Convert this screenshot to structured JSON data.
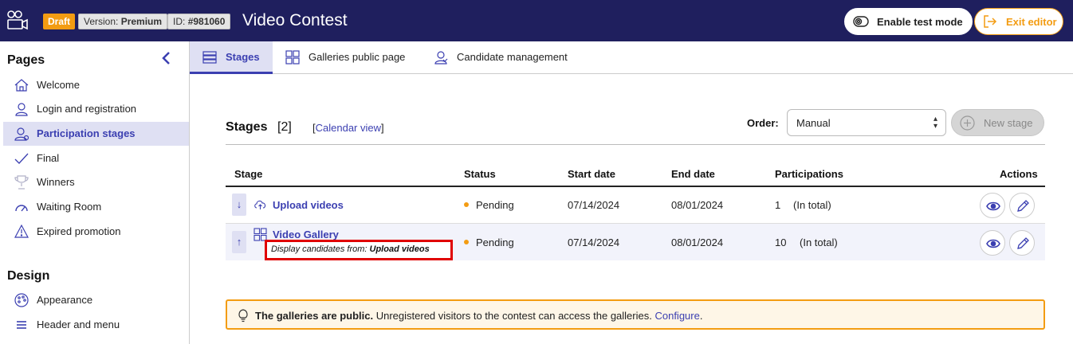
{
  "topbar": {
    "draft_label": "Draft",
    "version_prefix": "Version:",
    "version_value": "Premium",
    "id_prefix": "ID:",
    "id_value": "#981060",
    "title": "Video Contest",
    "test_mode_label": "Enable test mode",
    "exit_label": "Exit editor"
  },
  "sidebar": {
    "pages_heading": "Pages",
    "items": [
      {
        "label": "Welcome",
        "icon": "home-icon"
      },
      {
        "label": "Login and registration",
        "icon": "user-login-icon"
      },
      {
        "label": "Participation stages",
        "icon": "user-stages-icon"
      },
      {
        "label": "Final",
        "icon": "check-icon"
      },
      {
        "label": "Winners",
        "icon": "trophy-icon"
      },
      {
        "label": "Waiting Room",
        "icon": "gauge-icon"
      },
      {
        "label": "Expired promotion",
        "icon": "warning-icon"
      }
    ],
    "design_heading": "Design",
    "design_items": [
      {
        "label": "Appearance",
        "icon": "palette-icon"
      },
      {
        "label": "Header and menu",
        "icon": "menu-icon"
      }
    ]
  },
  "tabs": [
    {
      "label": "Stages",
      "icon": "list-icon"
    },
    {
      "label": "Galleries public page",
      "icon": "grid-icon"
    },
    {
      "label": "Candidate management",
      "icon": "candidates-icon"
    }
  ],
  "stages": {
    "title": "Stages",
    "count": "[2]",
    "calendar_link": "Calendar view",
    "order_label": "Order:",
    "order_value": "Manual",
    "new_stage_label": "New stage",
    "columns": [
      "Stage",
      "Status",
      "Start date",
      "End date",
      "Participations",
      "Actions"
    ],
    "rows": [
      {
        "name": "Upload videos",
        "icon": "cloud-upload-icon",
        "move": "↓",
        "status": "Pending",
        "start": "07/14/2024",
        "end": "08/01/2024",
        "participations": "1",
        "participations_note": "(In total)"
      },
      {
        "name": "Video Gallery",
        "icon": "gallery-grid-icon",
        "move": "↑",
        "sub_prefix": "Display candidates from:",
        "sub_value": "Upload videos",
        "status": "Pending",
        "start": "07/14/2024",
        "end": "08/01/2024",
        "participations": "10",
        "participations_note": "(In total)"
      }
    ]
  },
  "notice": {
    "bold": "The galleries are public.",
    "text": " Unregistered visitors to the contest can access the galleries. ",
    "link": "Configure",
    "end": "."
  },
  "colors": {
    "navy": "#1f1f5e",
    "accent": "#3b3fb1",
    "orange": "#f39c12",
    "highlight_red": "#e00000"
  }
}
